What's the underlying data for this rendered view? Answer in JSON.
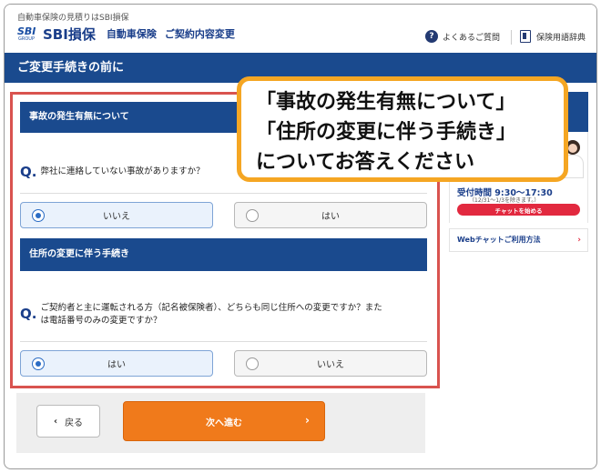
{
  "header": {
    "tagline": "自動車保険の見積りはSBI損保",
    "logo_mark": "SBI",
    "logo_group": "GROUP",
    "brand": "SBI損保",
    "product": "自動車保険",
    "page_name": "ご契約内容変更",
    "faq_label": "よくあるご質問",
    "glossary_label": "保険用語辞典"
  },
  "title": "ご変更手続きの前に",
  "sections": [
    {
      "heading": "事故の発生有無について",
      "question": "弊社に連絡していない事故がありますか？",
      "options": [
        {
          "label": "いいえ",
          "selected": true
        },
        {
          "label": "はい",
          "selected": false
        }
      ]
    },
    {
      "heading": "住所の変更に伴う手続き",
      "question_line1": "ご契約者と主に運転される方（記名被保険者）、どちらも同じ住所への変更ですか？また",
      "question_line2": "は電話番号のみの変更ですか？",
      "options": [
        {
          "label": "はい",
          "selected": true
        },
        {
          "label": "いいえ",
          "selected": false
        }
      ]
    }
  ],
  "q_mark": "Q.",
  "buttons": {
    "back": "戻る",
    "next": "次へ進む"
  },
  "sidebar": {
    "hours": "受付時間 9:30～17:30",
    "hours_note": "（12/31～1/3を除きます。）",
    "chat_button": "チャットを始める",
    "webchat_link": "Webチャットご利用方法"
  },
  "callout": {
    "line1": "「事故の発生有無について」",
    "line2": "「住所の変更に伴う手続き」",
    "line3": "についてお答えください"
  },
  "colors": {
    "brand_navy": "#1a4a8e",
    "accent_orange": "#f07a1b",
    "highlight_red": "#d9534f",
    "callout_border": "#f5a623"
  }
}
